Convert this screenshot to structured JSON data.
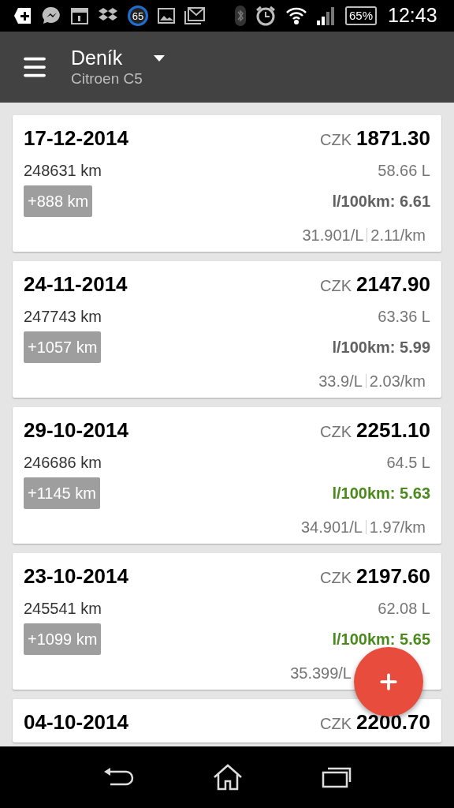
{
  "status_bar": {
    "badge_count": "65",
    "battery": "65%",
    "time": "12:43"
  },
  "toolbar": {
    "title": "Deník",
    "subtitle": "Citroen C5"
  },
  "entries": [
    {
      "date": "17-12-2014",
      "currency": "CZK",
      "amount": "1871.30",
      "odometer": "248631 km",
      "volume": "58.66 L",
      "distance": "+888 km",
      "efficiency": "l/100km: 6.61",
      "good": false,
      "unit_price": "31.901/L",
      "cost_per_km": "2.11/km"
    },
    {
      "date": "24-11-2014",
      "currency": "CZK",
      "amount": "2147.90",
      "odometer": "247743 km",
      "volume": "63.36 L",
      "distance": "+1057 km",
      "efficiency": "l/100km: 5.99",
      "good": false,
      "unit_price": "33.9/L",
      "cost_per_km": "2.03/km"
    },
    {
      "date": "29-10-2014",
      "currency": "CZK",
      "amount": "2251.10",
      "odometer": "246686 km",
      "volume": "64.5 L",
      "distance": "+1145 km",
      "efficiency": "l/100km: 5.63",
      "good": true,
      "unit_price": "34.901/L",
      "cost_per_km": "1.97/km"
    },
    {
      "date": "23-10-2014",
      "currency": "CZK",
      "amount": "2197.60",
      "odometer": "245541 km",
      "volume": "62.08 L",
      "distance": "+1099 km",
      "efficiency": "l/100km: 5.65",
      "good": true,
      "unit_price": "35.399/L"
    },
    {
      "date": "04-10-2014",
      "currency": "CZK",
      "amount": "2200.70"
    }
  ]
}
